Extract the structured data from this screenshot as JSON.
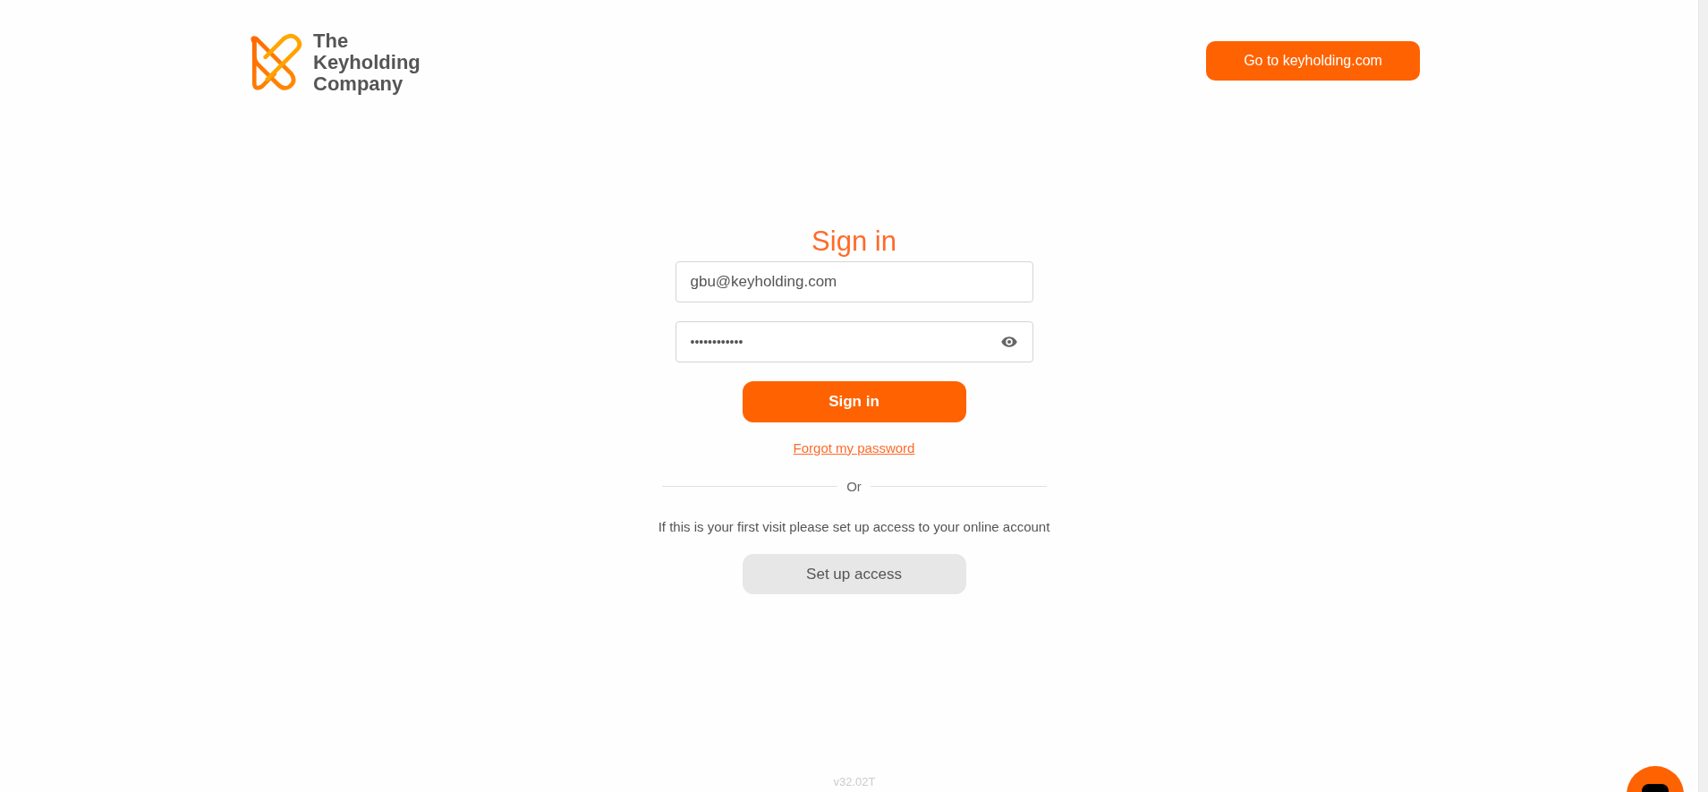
{
  "logo": {
    "lines": [
      "The",
      "Keyholding",
      "Company"
    ]
  },
  "header": {
    "button": "Go to keyholding.com"
  },
  "signin": {
    "title": "Sign in",
    "email": {
      "value": "gbu@keyholding.com"
    },
    "password": {
      "value": "••••••••••••",
      "revealed": false
    },
    "button": "Sign in",
    "forgot": "Forgot my password",
    "divider": "Or",
    "first_visit": "If this is your first visit please set up access to your online account",
    "setup_button": "Set up access"
  },
  "version": "v32.02T"
}
